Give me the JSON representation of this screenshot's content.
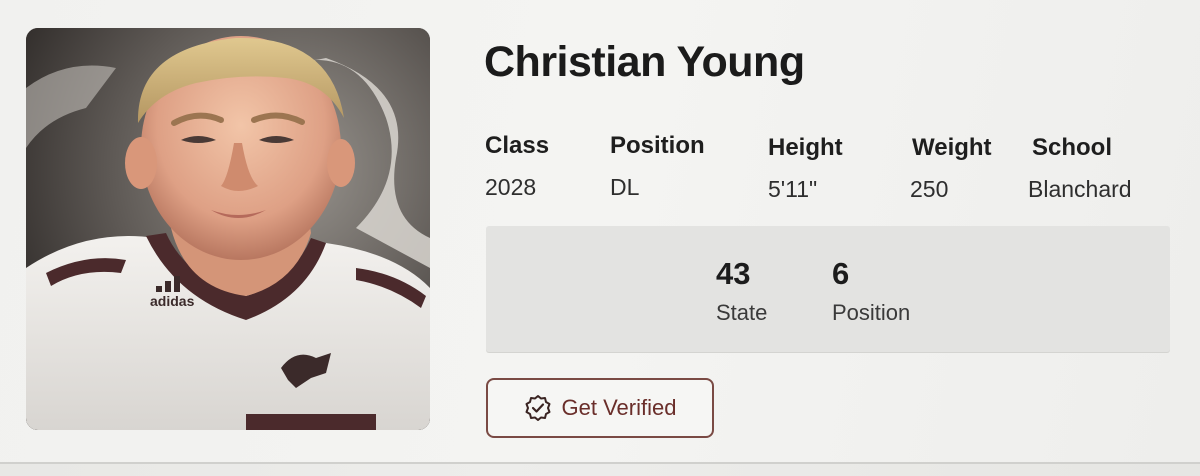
{
  "player": {
    "name": "Christian Young"
  },
  "attributes": [
    {
      "label": "Class",
      "value": "2028"
    },
    {
      "label": "Position",
      "value": "DL"
    },
    {
      "label": "Height",
      "value": "5'11\""
    },
    {
      "label": "Weight",
      "value": "250"
    },
    {
      "label": "School",
      "value": "Blanchard"
    }
  ],
  "rankings": [
    {
      "value": "43",
      "label": "State"
    },
    {
      "value": "6",
      "label": "Position"
    }
  ],
  "actions": {
    "verify_label": "Get Verified",
    "verify_icon": "badge-check-icon"
  },
  "photo": {
    "jersey_brand": "adidas"
  },
  "colors": {
    "accent": "#6a2e2a",
    "text": "#1b1b1b",
    "panel": "#e3e3e1"
  }
}
